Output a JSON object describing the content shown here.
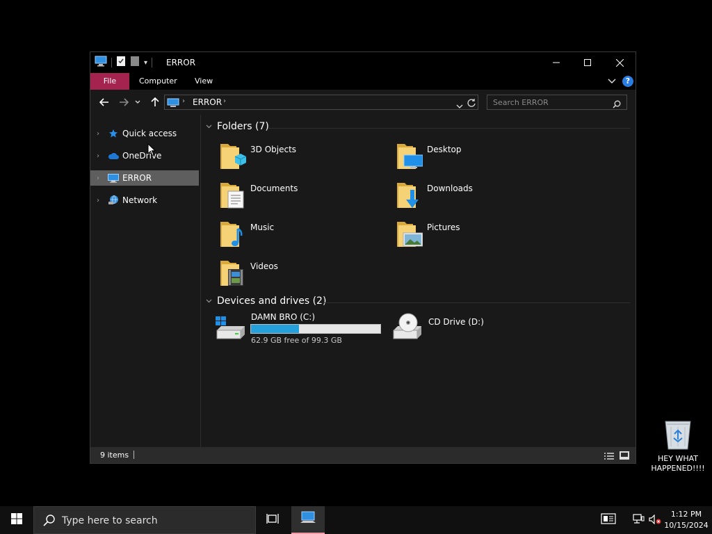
{
  "window": {
    "title": "ERROR",
    "controls": {
      "minimize": "—",
      "maximize": "☐",
      "close": "✕"
    }
  },
  "ribbon": {
    "tabs": [
      "File",
      "Computer",
      "View"
    ],
    "help": "?"
  },
  "address": {
    "path": "ERROR",
    "search_placeholder": "Search ERROR"
  },
  "nav": {
    "items": [
      {
        "label": "Quick access",
        "icon": "star-icon"
      },
      {
        "label": "OneDrive",
        "icon": "cloud-icon"
      },
      {
        "label": "ERROR",
        "icon": "computer-icon",
        "selected": true
      },
      {
        "label": "Network",
        "icon": "network-icon"
      }
    ]
  },
  "content": {
    "folders_header": "Folders (7)",
    "folders": [
      {
        "label": "3D Objects",
        "icon": "3d-objects-folder-icon"
      },
      {
        "label": "Desktop",
        "icon": "desktop-folder-icon"
      },
      {
        "label": "Documents",
        "icon": "documents-folder-icon"
      },
      {
        "label": "Downloads",
        "icon": "downloads-folder-icon"
      },
      {
        "label": "Music",
        "icon": "music-folder-icon"
      },
      {
        "label": "Pictures",
        "icon": "pictures-folder-icon"
      },
      {
        "label": "Videos",
        "icon": "videos-folder-icon"
      }
    ],
    "drives_header": "Devices and drives (2)",
    "drives": [
      {
        "label": "DAMN BRO (C:)",
        "free": "62.9 GB free of 99.3 GB",
        "used_fraction": 0.37
      },
      {
        "label": "CD Drive (D:)"
      }
    ]
  },
  "status": {
    "items": "9 items"
  },
  "desktop": {
    "recycle_label_line1": "HEY WHAT",
    "recycle_label_line2": "HAPPENED!!!!"
  },
  "taskbar": {
    "search_placeholder": "Type here to search",
    "time": "1:12 PM",
    "date": "10/15/2024"
  },
  "colors": {
    "file_tab": "#a5234f",
    "progress": "#26a0da",
    "selection": "#5e5e5e",
    "taskbar_accent": "#f09aa6"
  }
}
